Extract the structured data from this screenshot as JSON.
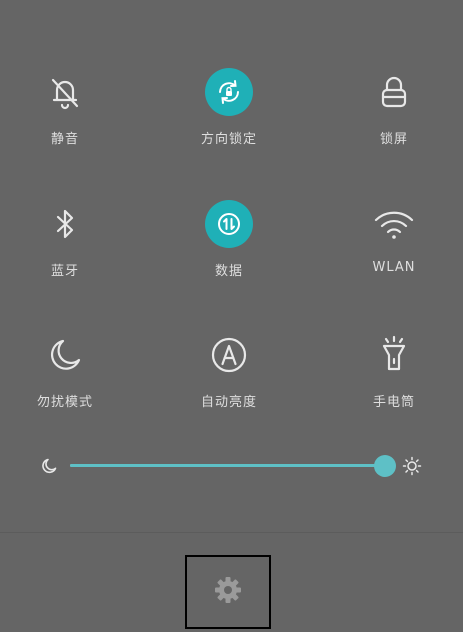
{
  "quick_settings": {
    "tiles": [
      {
        "label": "静音",
        "icon": "bell-off-icon",
        "active": false
      },
      {
        "label": "方向锁定",
        "icon": "rotation-lock-icon",
        "active": true
      },
      {
        "label": "锁屏",
        "icon": "lock-icon",
        "active": false
      },
      {
        "label": "蓝牙",
        "icon": "bluetooth-icon",
        "active": false
      },
      {
        "label": "数据",
        "icon": "mobile-data-icon",
        "active": true
      },
      {
        "label": "WLAN",
        "icon": "wifi-icon",
        "active": false
      },
      {
        "label": "勿扰模式",
        "icon": "moon-icon",
        "active": false
      },
      {
        "label": "自动亮度",
        "icon": "auto-brightness-icon",
        "active": false
      },
      {
        "label": "手电筒",
        "icon": "flashlight-icon",
        "active": false
      }
    ]
  },
  "brightness": {
    "level_percent": 100,
    "min_icon": "moon-icon",
    "max_icon": "sun-icon"
  },
  "footer": {
    "settings_icon": "gear-icon"
  },
  "colors": {
    "background": "#656565",
    "accent": "#1fb0b7",
    "slider": "#5ec0c6",
    "label": "#dedede"
  }
}
